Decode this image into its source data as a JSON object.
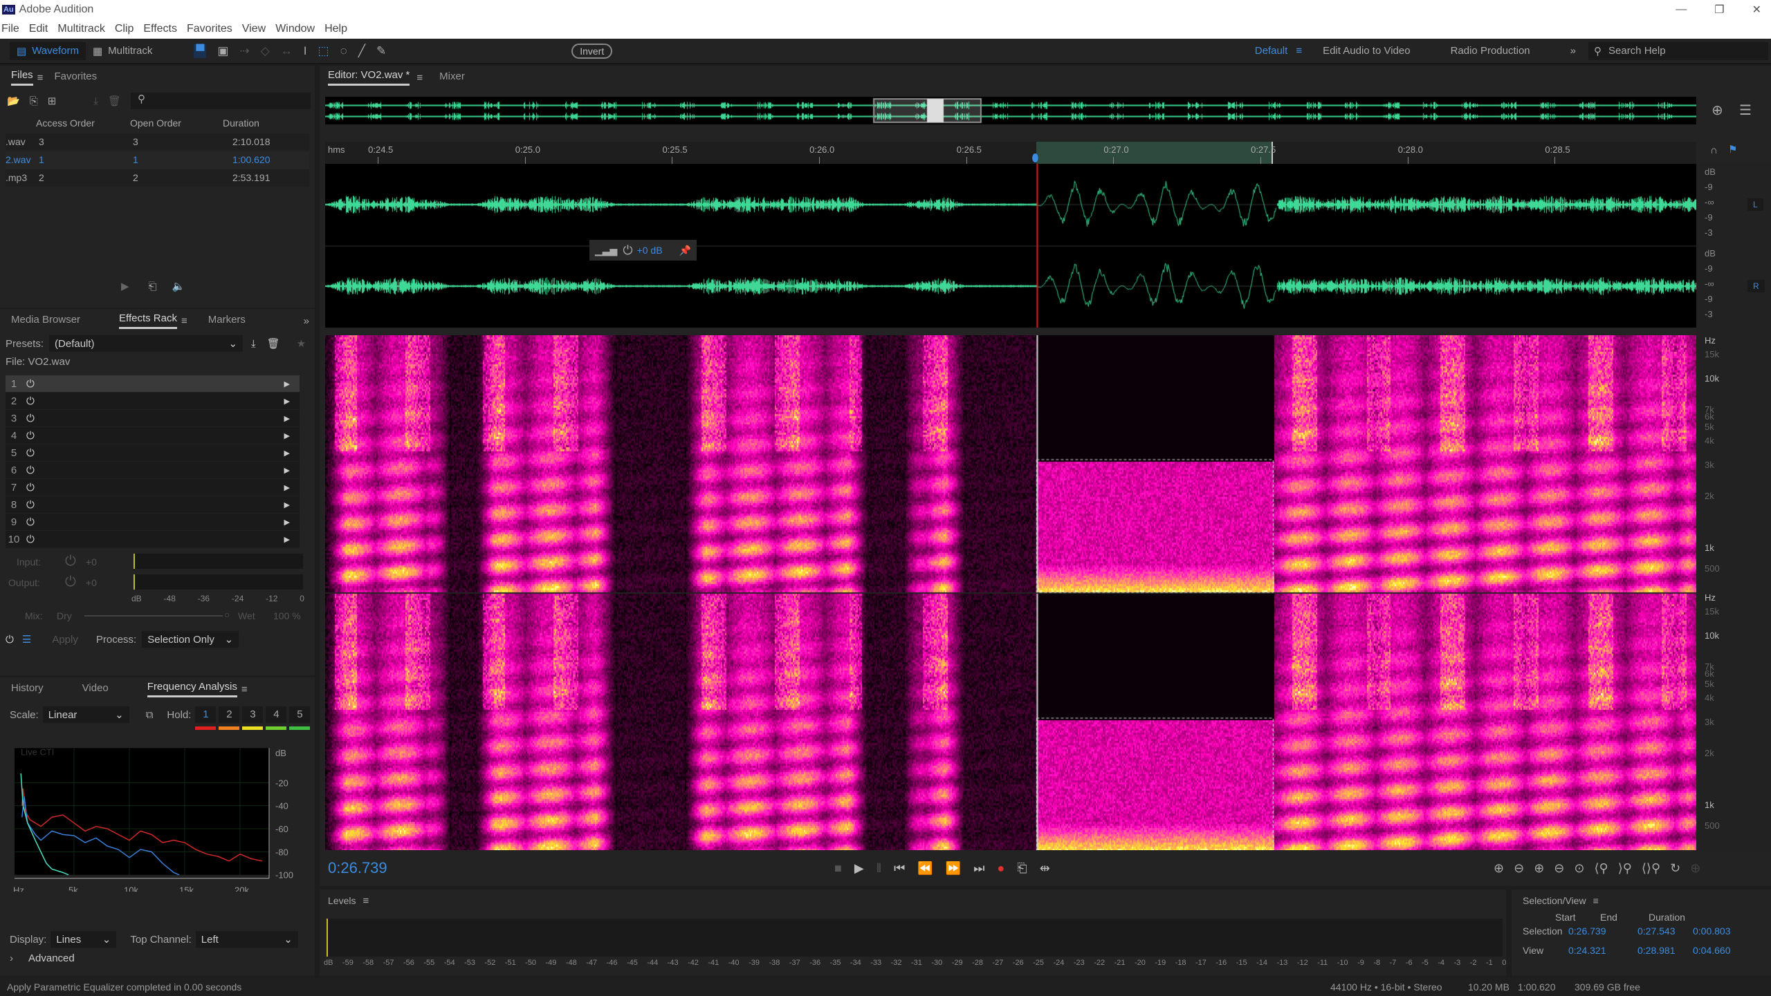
{
  "app": {
    "title": "Adobe Audition",
    "logo": "Au"
  },
  "menu": [
    "File",
    "Edit",
    "Multitrack",
    "Clip",
    "Effects",
    "Favorites",
    "View",
    "Window",
    "Help"
  ],
  "toolbar": {
    "waveform": "Waveform",
    "multitrack": "Multitrack",
    "invert": "Invert",
    "workspaces": [
      "Default",
      "Edit Audio to Video",
      "Radio Production"
    ],
    "search_placeholder": "Search Help"
  },
  "files": {
    "tabs": [
      "Files",
      "Favorites"
    ],
    "columns": [
      "Access Order",
      "Open Order",
      "Duration"
    ],
    "rows": [
      {
        "name": ".wav",
        "access": "3",
        "open": "3",
        "duration": "2:10.018",
        "selected": false
      },
      {
        "name": "2.wav",
        "access": "1",
        "open": "1",
        "duration": "1:00.620",
        "selected": true
      },
      {
        "name": ".mp3",
        "access": "2",
        "open": "2",
        "duration": "2:53.191",
        "selected": false
      }
    ]
  },
  "effects": {
    "tabs": [
      "Media Browser",
      "Effects Rack",
      "Markers"
    ],
    "presets_label": "Presets:",
    "preset": "(Default)",
    "file_label": "File: VO2.wav",
    "slots": [
      "1",
      "2",
      "3",
      "4",
      "5",
      "6",
      "7",
      "8",
      "9",
      "10"
    ],
    "input_label": "Input:",
    "input_value": "+0",
    "output_label": "Output:",
    "output_value": "+0",
    "meter_ticks": [
      "dB",
      "-48",
      "-36",
      "-24",
      "-12",
      "0"
    ],
    "mix_label": "Mix:",
    "dry": "Dry",
    "wet": "Wet",
    "wet_value": "100 %",
    "apply": "Apply",
    "process_label": "Process:",
    "process": "Selection Only"
  },
  "freq": {
    "tabs": [
      "History",
      "Video",
      "Frequency Analysis"
    ],
    "scale_label": "Scale:",
    "scale": "Linear",
    "hold_label": "Hold:",
    "holds": [
      {
        "n": "1",
        "color": "#e02020"
      },
      {
        "n": "2",
        "color": "#f08020"
      },
      {
        "n": "3",
        "color": "#e8e020"
      },
      {
        "n": "4",
        "color": "#70d030"
      },
      {
        "n": "5",
        "color": "#40c040"
      }
    ],
    "live": "Live CTI",
    "x_ticks": [
      "Hz",
      "5k",
      "10k",
      "15k",
      "20k"
    ],
    "y_ticks": [
      "dB",
      "-20",
      "-40",
      "-60",
      "-80",
      "-100"
    ],
    "display_label": "Display:",
    "display": "Lines",
    "top_channel_label": "Top Channel:",
    "top_channel": "Left",
    "advanced": "Advanced"
  },
  "chart_data": {
    "type": "line",
    "xlabel": "Hz",
    "ylabel": "dB",
    "xlim": [
      0,
      22050
    ],
    "ylim": [
      -100,
      10
    ],
    "series": [
      {
        "color": "#d02828",
        "x": [
          300,
          400,
          600,
          1000,
          2000,
          3000,
          4000,
          5000,
          6000,
          7000,
          8000,
          9000,
          10000,
          11000,
          12000,
          13000,
          14000,
          15000,
          16000,
          17000,
          18000,
          19000,
          20000,
          21000,
          22000
        ],
        "y": [
          -40,
          -25,
          -45,
          -52,
          -58,
          -50,
          -48,
          -55,
          -62,
          -58,
          -60,
          -65,
          -70,
          -62,
          -65,
          -72,
          -70,
          -72,
          -78,
          -82,
          -84,
          -88,
          -82,
          -86,
          -88
        ]
      },
      {
        "color": "#3a7fd8",
        "x": [
          300,
          500,
          800,
          1500,
          2000,
          3000,
          4000,
          5000,
          6000,
          7000,
          8000,
          9000,
          10000,
          11000,
          12000,
          13000,
          14000,
          14500
        ],
        "y": [
          -50,
          -32,
          -55,
          -65,
          -70,
          -62,
          -65,
          -66,
          -72,
          -68,
          -75,
          -78,
          -85,
          -78,
          -80,
          -90,
          -98,
          -100
        ]
      },
      {
        "color": "#4fe0c0",
        "x": [
          200,
          400,
          800,
          1500,
          2500,
          3000,
          4000,
          4500
        ],
        "y": [
          -12,
          -40,
          -55,
          -70,
          -90,
          -95,
          -98,
          -100
        ]
      }
    ]
  },
  "editor": {
    "tabs": [
      "Editor: VO2.wav *",
      "Mixer"
    ],
    "ruler_unit": "hms",
    "ruler": [
      "0:24.5",
      "0:25.0",
      "0:25.5",
      "0:26.0",
      "0:26.5",
      "0:27.0",
      "0:27.5",
      "0:28.0",
      "0:28.5"
    ],
    "view_start": 24.321,
    "view_end": 28.981,
    "sel_start": 26.739,
    "sel_end": 27.543,
    "clip_gain": "+0 dB",
    "channels": [
      "L",
      "R"
    ],
    "db_scale": [
      "dB",
      "-9",
      "-∞",
      "-9",
      "-3"
    ],
    "hz_scale": [
      "Hz",
      "15k",
      "10k",
      "7k",
      "6k",
      "5k",
      "4k",
      "3k",
      "2k",
      "1k",
      "500"
    ],
    "time": "0:26.739"
  },
  "levels": {
    "title": "Levels",
    "min": -59,
    "max": 0
  },
  "selection_view": {
    "title": "Selection/View",
    "cols": [
      "Start",
      "End",
      "Duration"
    ],
    "rows": [
      {
        "label": "Selection",
        "start": "0:26.739",
        "end": "0:27.543",
        "duration": "0:00.803"
      },
      {
        "label": "View",
        "start": "0:24.321",
        "end": "0:28.981",
        "duration": "0:04.660"
      }
    ]
  },
  "status": {
    "message": "Apply Parametric Equalizer completed in 0.00 seconds",
    "format": "44100 Hz • 16-bit • Stereo",
    "size": "10.20 MB",
    "duration": "1:00.620",
    "free": "309.69 GB free"
  },
  "colors": {
    "accent": "#3c8de0",
    "waveform": "#3fd896",
    "selection": "#2e4a3e",
    "playhead": "#e02020"
  }
}
